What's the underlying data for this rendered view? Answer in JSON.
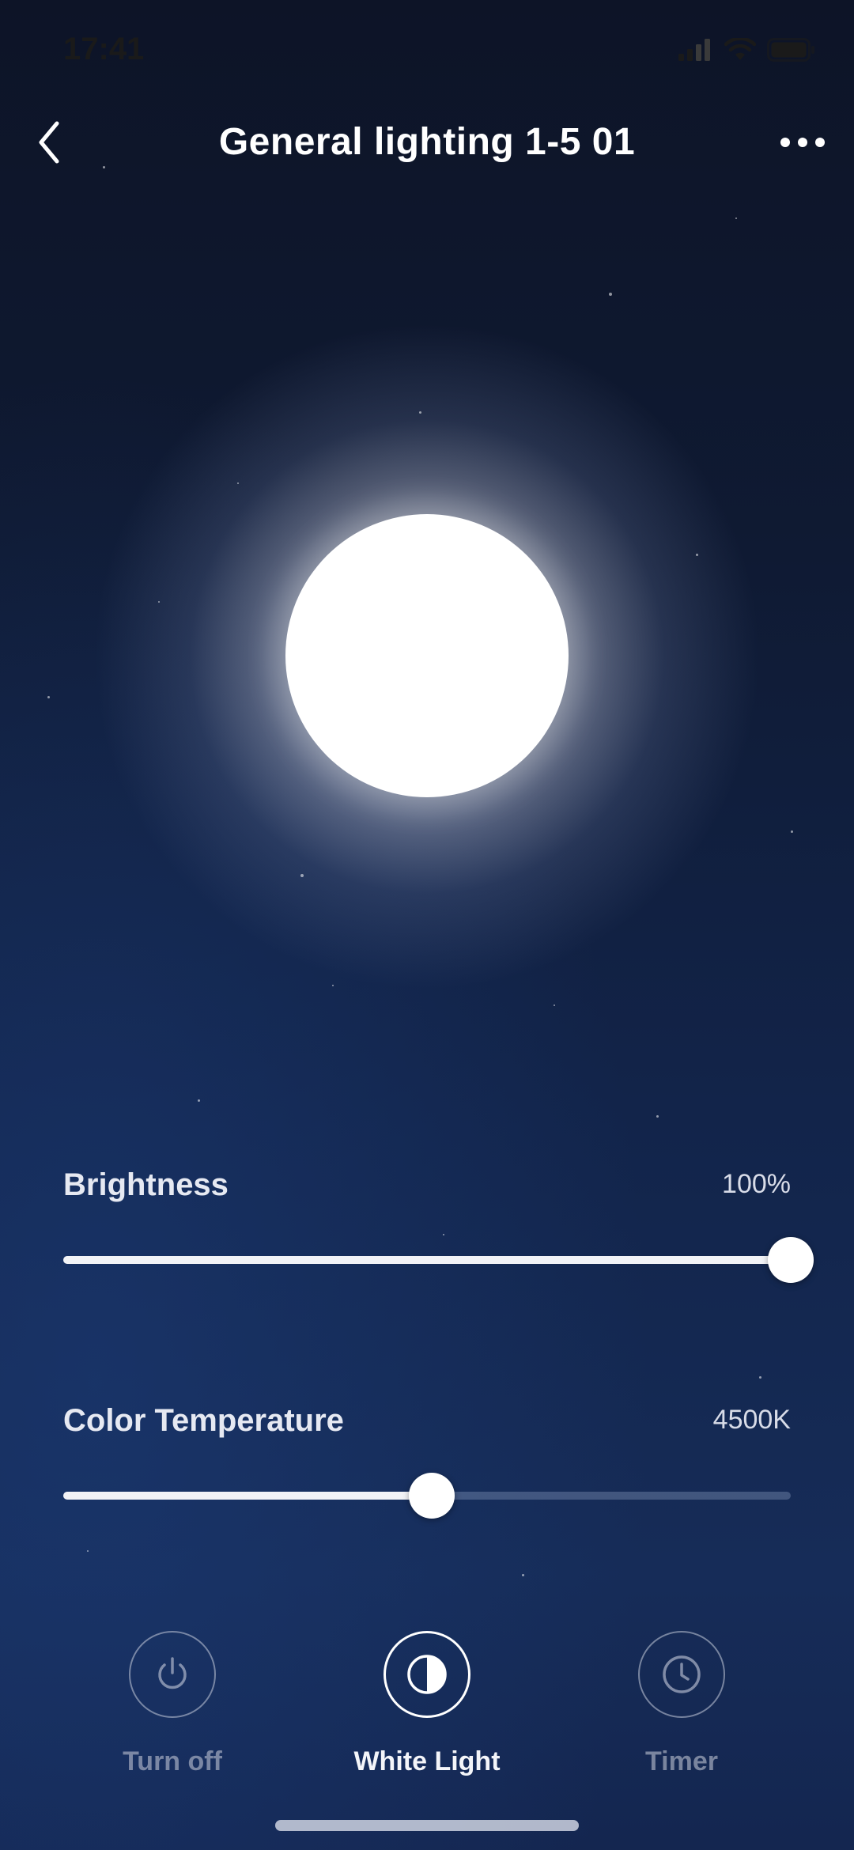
{
  "status_bar": {
    "time": "17:41",
    "icons": [
      "cellular-signal-icon",
      "wifi-icon",
      "battery-icon"
    ]
  },
  "header": {
    "title": "General lighting 1-5 01",
    "back_icon": "chevron-left-icon",
    "more_icon": "more-dots-icon"
  },
  "brightness": {
    "label": "Brightness",
    "value": "100%",
    "level": 1.0
  },
  "color_temperature": {
    "label": "Color Temperature",
    "value": "4500K",
    "level": 0.506
  },
  "actions": [
    {
      "label": "Turn off",
      "icon": "power-icon",
      "active": false
    },
    {
      "label": "White Light",
      "icon": "half-circle-icon",
      "active": true
    },
    {
      "label": "Timer",
      "icon": "clock-icon",
      "active": false
    }
  ],
  "colors": {
    "background_top": "#0d1427",
    "background_bottom": "#162c58",
    "light_color": "#ffffff",
    "inactive_label": "#bec3d2"
  }
}
